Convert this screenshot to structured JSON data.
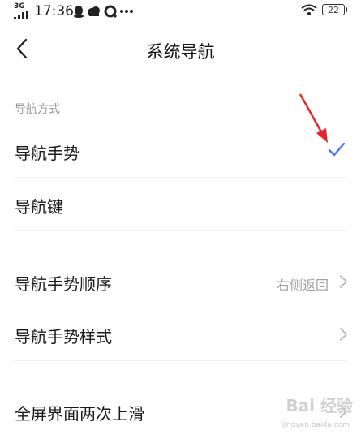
{
  "status_bar": {
    "network": "3G",
    "time": "17:36",
    "battery": "22"
  },
  "header": {
    "title": "系统导航"
  },
  "section": {
    "label": "导航方式"
  },
  "options": [
    {
      "label": "导航手势",
      "selected": true
    },
    {
      "label": "导航键",
      "selected": false
    }
  ],
  "settings": [
    {
      "label": "导航手势顺序",
      "value": "右侧返回"
    },
    {
      "label": "导航手势样式"
    },
    {
      "label": "全屏界面两次上滑"
    }
  ],
  "watermark": {
    "text": "Bai 经验",
    "url": "jingyan.baidu.com"
  },
  "colors": {
    "accent": "#4a76f6",
    "annotation_arrow": "#e8262a"
  }
}
